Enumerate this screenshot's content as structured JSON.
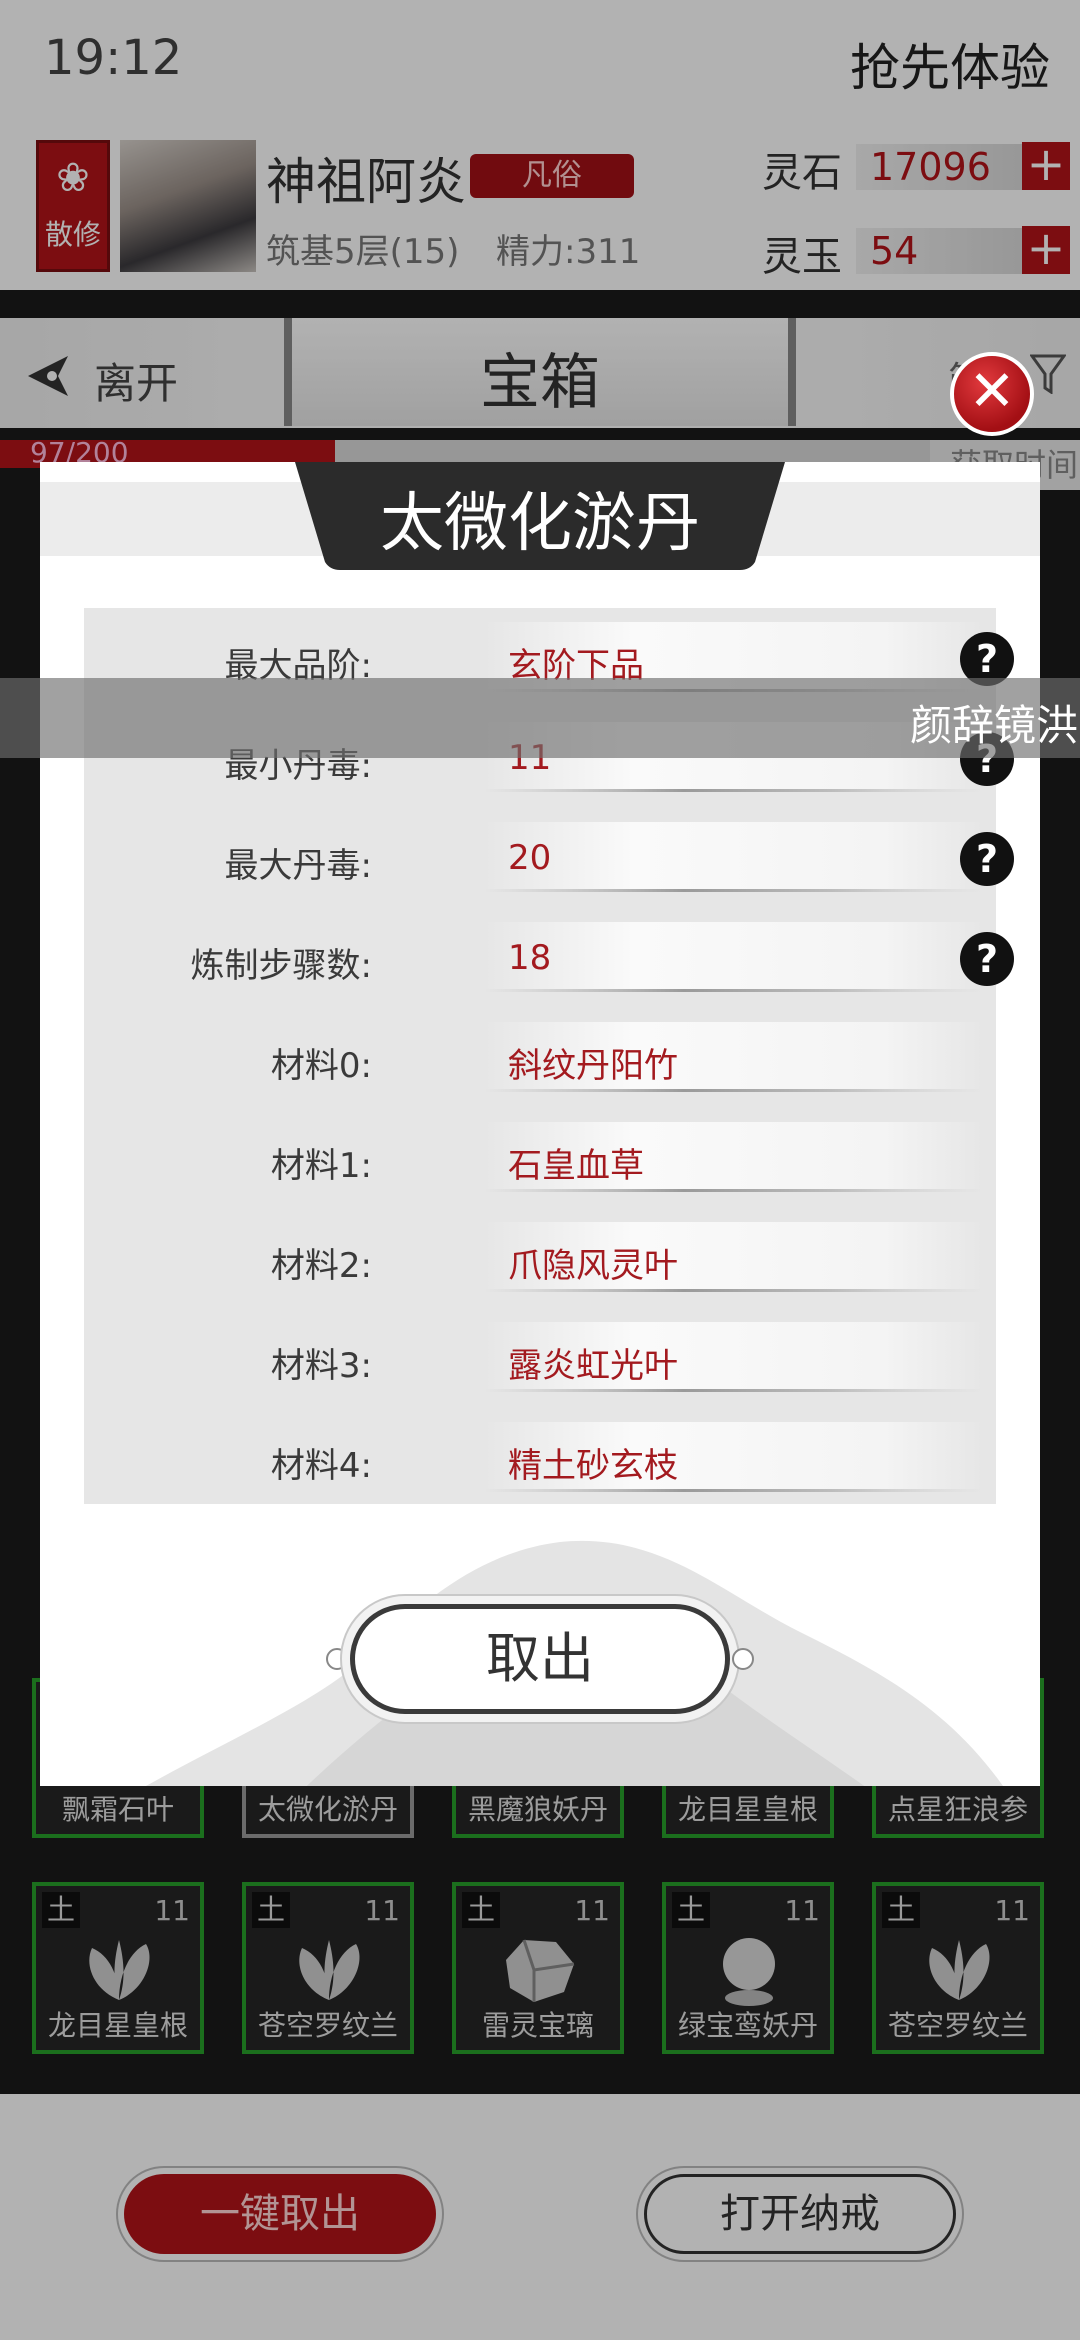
{
  "status_bar": {
    "time": "19:12",
    "promo": "抢先体验"
  },
  "profile": {
    "sect": "散修",
    "name": "神祖阿炎",
    "rank": "凡俗",
    "level": "筑基5层(15)",
    "energy": "精力:311",
    "currencies": [
      {
        "label": "灵石",
        "value": "17096"
      },
      {
        "label": "灵玉",
        "value": "54"
      }
    ]
  },
  "nav": {
    "back": "离开",
    "title": "宝箱",
    "filter": "筛",
    "sort": "获取时间"
  },
  "progress": {
    "text": "97/200",
    "fraction": 0.36
  },
  "grid": {
    "row_a": [
      {
        "element": "",
        "count": "",
        "name": "飘霜石叶"
      },
      {
        "element": "",
        "count": "",
        "name": "太微化淤丹",
        "selected": true
      },
      {
        "element": "",
        "count": "",
        "name": "黑魔狼妖丹"
      },
      {
        "element": "",
        "count": "",
        "name": "龙目星皇根"
      },
      {
        "element": "",
        "count": "",
        "name": "点星狂浪参"
      }
    ],
    "row_b": [
      {
        "element": "土",
        "count": "11",
        "name": "龙目星皇根",
        "icon": "leaf-icon"
      },
      {
        "element": "土",
        "count": "11",
        "name": "苍空罗纹兰",
        "icon": "leaf-icon"
      },
      {
        "element": "土",
        "count": "11",
        "name": "雷灵宝璃",
        "icon": "ore-icon"
      },
      {
        "element": "土",
        "count": "11",
        "name": "绿宝鸾妖丹",
        "icon": "orb-icon"
      },
      {
        "element": "土",
        "count": "11",
        "name": "苍空罗纹兰",
        "icon": "leaf-icon"
      }
    ]
  },
  "bottom": {
    "take_all": "一键取出",
    "open_ring": "打开纳戒"
  },
  "danmaku": "颜辞镜洪",
  "modal": {
    "title": "太微化淤丹",
    "rows": [
      {
        "label": "最大品阶:",
        "value": "玄阶下品",
        "help": true
      },
      {
        "label": "最小丹毒:",
        "value": "11",
        "help": true
      },
      {
        "label": "最大丹毒:",
        "value": "20",
        "help": true
      },
      {
        "label": "炼制步骤数:",
        "value": "18",
        "help": true
      },
      {
        "label": "材料0:",
        "value": "斜纹丹阳竹",
        "help": false
      },
      {
        "label": "材料1:",
        "value": "石皇血草",
        "help": false
      },
      {
        "label": "材料2:",
        "value": "爪隐风灵叶",
        "help": false
      },
      {
        "label": "材料3:",
        "value": "露炎虹光叶",
        "help": false
      },
      {
        "label": "材料4:",
        "value": "精土砂玄枝",
        "help": false
      }
    ],
    "take_out": "取出",
    "close_icon": "close-icon",
    "help_glyph": "?"
  },
  "colors": {
    "accent_red": "#b21419",
    "value_red": "#a31a1f",
    "grid_border": "#27a02a"
  }
}
